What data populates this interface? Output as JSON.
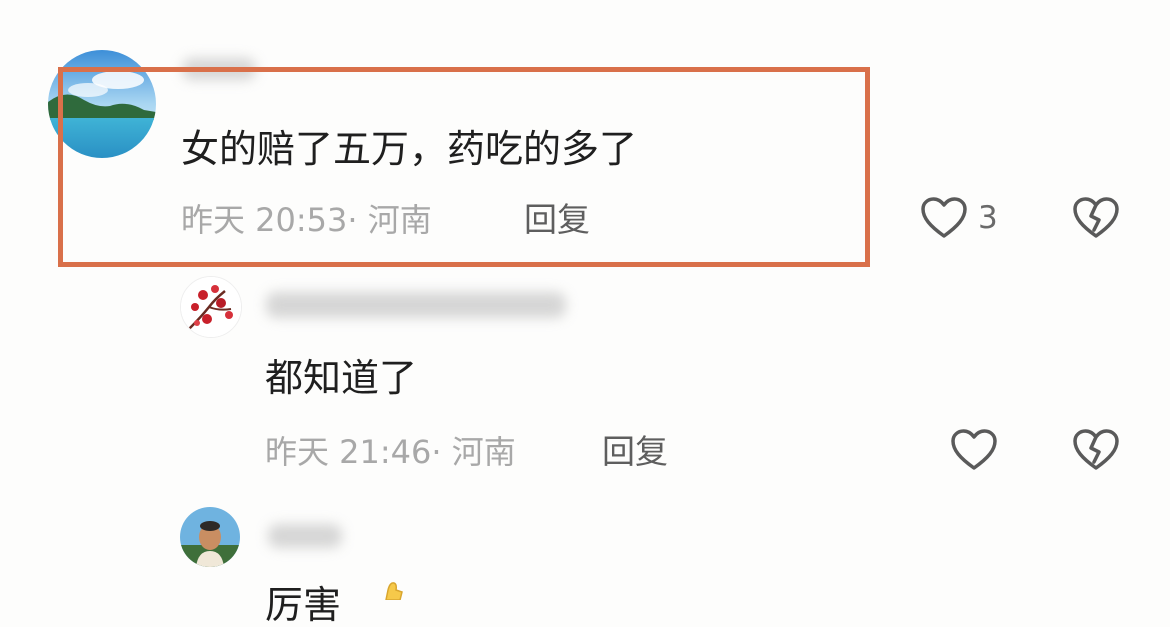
{
  "comments": [
    {
      "text": "女的赔了五万，药吃的多了",
      "time": "昨天 20:53",
      "location": "· 河南",
      "reply_label": "回复",
      "likes": "3",
      "highlighted": true
    },
    {
      "text": "都知道了",
      "time": "昨天 21:46",
      "location": "· 河南",
      "reply_label": "回复",
      "likes": ""
    },
    {
      "text": "厉害"
    }
  ],
  "icons": {
    "like": "heart-outline-icon",
    "dislike": "broken-heart-icon"
  },
  "colors": {
    "highlight": "#d9704a",
    "meta_text": "#a8a8a8"
  }
}
